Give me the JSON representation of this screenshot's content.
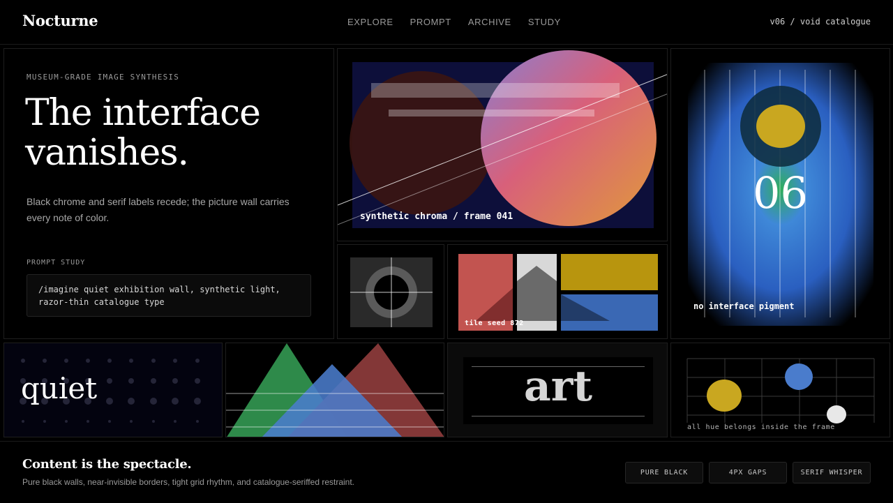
{
  "header": {
    "brand": "Nocturne",
    "nav": [
      "EXPLORE",
      "PROMPT",
      "ARCHIVE",
      "STUDY"
    ],
    "version": "v06 / void catalogue"
  },
  "hero": {
    "eyebrow": "MUSEUM-GRADE IMAGE SYNTHESIS",
    "title_line1": "The interface",
    "title_line2": "vanishes.",
    "description": "Black chrome and serif labels recede; the picture wall carries every note of color.",
    "prompt_label": "PROMPT STUDY",
    "prompt_text": "/imagine quiet exhibition wall, synthetic light, razor-thin catalogue type"
  },
  "tiles": {
    "chroma_caption": "synthetic chroma / frame 041",
    "tile_seed_caption": "tile seed 872",
    "poster_number": "06",
    "poster_caption": "no interface pigment",
    "quiet_word": "quiet",
    "art_word": "art",
    "grid_caption": "all hue belongs inside the frame"
  },
  "footer": {
    "title": "Content is the spectacle.",
    "description": "Pure black walls, near-invisible borders, tight grid rhythm, and catalogue-seriffed restraint.",
    "chips": [
      "PURE BLACK",
      "4PX GAPS",
      "SERIF WHISPER"
    ]
  },
  "colors": {
    "background": "#000000",
    "red": "#c25450",
    "yellow": "#c9a720",
    "blue": "#4a7ccc",
    "green": "#2e8a4a"
  }
}
